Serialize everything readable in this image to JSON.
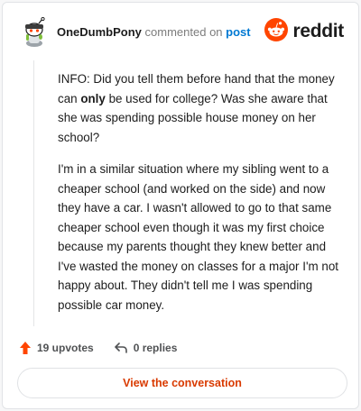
{
  "header": {
    "username": "OneDumbPony",
    "commented_on": "commented on",
    "post_link": "post",
    "brand": "reddit"
  },
  "comment": {
    "p1_before": "INFO: Did you tell them before hand that the money can ",
    "p1_bold": "only",
    "p1_after": " be used for college? Was she aware that she was spending possible house money on her school?",
    "p2": "I'm in a similar situation where my sibling went to a cheaper school (and worked on the side) and now they have a car. I wasn't allowed to go to that same cheaper school even though it was my first choice because my parents thought they knew better and I've wasted the money on classes for a major I'm not happy about. They didn't tell me I was spending possible car money."
  },
  "actions": {
    "upvotes": "19 upvotes",
    "replies": "0 replies"
  },
  "cta": {
    "label": "View the conversation"
  },
  "colors": {
    "upvote": "#ff4500",
    "brand": "#ff4500",
    "link": "#0079d3",
    "cta": "#d93a00"
  },
  "icons": {
    "avatar": "snoo-avatar-icon",
    "brand": "reddit-logo-icon",
    "upvote": "upvote-arrow-icon",
    "reply": "reply-arrow-icon"
  }
}
